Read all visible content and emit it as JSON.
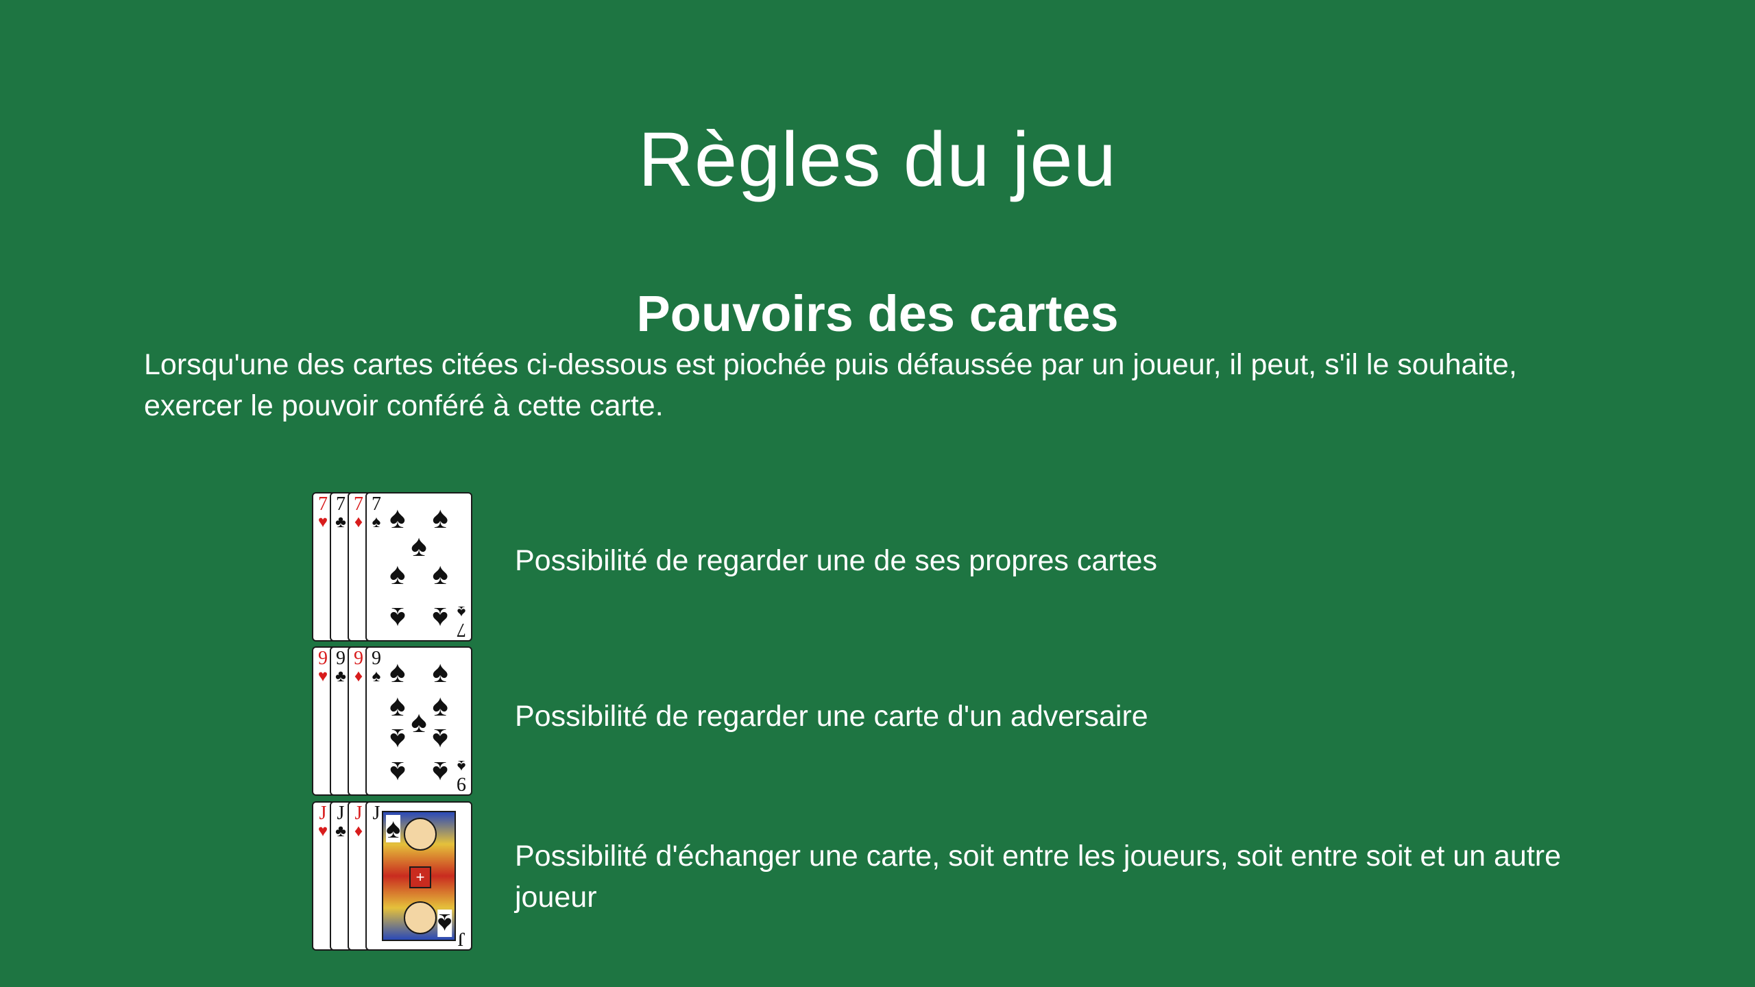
{
  "page": {
    "title": "Règles du jeu",
    "section_title": "Pouvoirs des cartes",
    "intro": "Lorsqu'une des cartes citées ci-dessous est piochée puis défaussée par un joueur, il peut, s'il le souhaite, exercer le pouvoir conféré à cette carte.",
    "background_color": "#1e7542",
    "text_color": "#ffffff"
  },
  "powers": [
    {
      "rank": "7",
      "suits": [
        "heart",
        "club",
        "diamond",
        "spade"
      ],
      "description": "Possibilité de regarder une de ses propres cartes"
    },
    {
      "rank": "9",
      "suits": [
        "heart",
        "club",
        "diamond",
        "spade"
      ],
      "description": "Possibilité de regarder une carte d'un adversaire"
    },
    {
      "rank": "J",
      "suits": [
        "heart",
        "club",
        "diamond",
        "spade"
      ],
      "description": "Possibilité d'échanger une carte, soit entre les joueurs, soit entre soit et un autre joueur"
    }
  ],
  "suit_glyphs": {
    "heart": "♥",
    "club": "♣",
    "diamond": "♦",
    "spade": "♠"
  }
}
